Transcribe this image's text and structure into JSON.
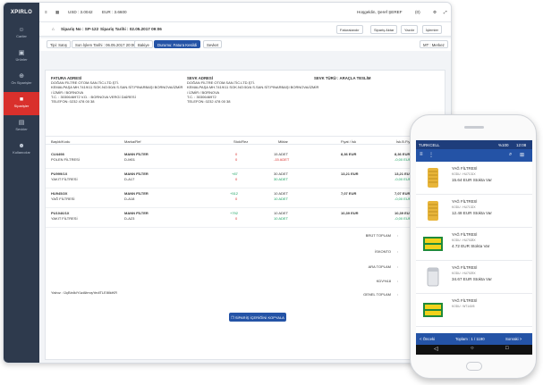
{
  "app": {
    "logo": "XPIRLO",
    "sidebar": [
      {
        "label": "Cariler",
        "icon": "user-icon"
      },
      {
        "label": "Ürünler",
        "icon": "box-icon"
      },
      {
        "label": "Ön Siparişler",
        "icon": "cart-icon"
      },
      {
        "label": "Siparişler",
        "icon": "bag-icon",
        "active": true
      },
      {
        "label": "Sevkler",
        "icon": "truck-icon"
      },
      {
        "label": "Kullanıcılar",
        "icon": "users-icon"
      }
    ],
    "topbar": {
      "menu_icon": "≡",
      "grid_icon": "▦",
      "usd": "USD : 3.0042",
      "eur": "EUR : 3.6600",
      "greeting": "Hoşgeldin, Şeref ŞEREF",
      "lang": "(0)"
    },
    "order": {
      "no": "Sipariş No : SP-122",
      "date": "Sipariş Tarihi : 02.05.2017 09:06",
      "buttons": [
        "Faturalandır",
        "Sipariş Aktar",
        "Yazdır",
        "İşlemler"
      ]
    },
    "status": {
      "type": "Tipi: Satış",
      "last_update": "Son İşlem Tarihi : 06.05.2017 20:06",
      "balance": "Bakiye",
      "state": "Durumu: Fatura Kesildi",
      "shipment": "Sevket",
      "warehouse": "MT : Merkez"
    },
    "addresses": {
      "invoice_title": "FATURA ADRESİ",
      "invoice_lines": [
        "DOĞAN FİLTRE OTOM.SAN.TİC.LTD.ŞTİ.",
        "KEMALPAŞA MH.7419/11 SOK.NO:50/A S.SAN.SİT.PINARBAŞI BORNOVA/İZMİR",
        "/ İZMİR / BORNOVA",
        "T.C. : 3030646972 V.D. : BORNOVA VERGİ DAİRESİ",
        "TELEFON: 0232 478 00 38"
      ],
      "shipping_title": "SEVK ADRESİ",
      "shipping_lines": [
        "DOĞAN FİLTRE OTOM.SAN.TİC.LTD.ŞTİ.",
        "KEMALPAŞA MH.7419/11 SOK.NO:50/A S.SAN.SİT.PINARBAŞI BORNOVA/İZMİR",
        "/ İZMİR / BORNOVA",
        "T.C. : 3030646972",
        "TELEFON: 0232 478 00 38"
      ],
      "shipping_type": "SEVK TÜRÜ : ARAÇLA TESLİM"
    },
    "table": {
      "headers": [
        "Başlık/Kodu",
        "Marka/Ref",
        "Stok/Rez",
        "Miktar",
        "Fiyat / İsk",
        "İsk.B.Fiyat"
      ],
      "rows": [
        {
          "code": "CU4498",
          "name": "POLEN FİLTRESİ",
          "brand": "MANN FİLTER",
          "ref": "D-M01",
          "stock": "0",
          "rez": "0",
          "qty": "15 ADET",
          "qty2": "-15 ADET",
          "price": "8,36 EUR",
          "disc": "",
          "final": "8,36 EUR",
          "final2": "-0,00 EUR"
        },
        {
          "code": "PU999/1X",
          "name": "YAKIT FİLTRESİ",
          "brand": "MANN FİLTER",
          "ref": "D-A17",
          "stock": "+87",
          "rez": "0",
          "qty": "30 ADET",
          "qty2": "30 ADET",
          "price": "13,21 EUR",
          "disc": "",
          "final": "13,21 EUR",
          "final2": "-0,00 EUR"
        },
        {
          "code": "HU945/2X",
          "name": "YAĞ FİLTRESİ",
          "brand": "MANN FİLTER",
          "ref": "D-A18",
          "stock": "+512",
          "rez": "0",
          "qty": "10 ADET",
          "qty2": "10 ADET",
          "price": "7,07 EUR",
          "disc": "",
          "final": "7,07 EUR",
          "final2": "-0,00 EUR"
        },
        {
          "code": "PU1046/1X",
          "name": "YAKIT FİLTRESİ",
          "brand": "MANN FİLTER",
          "ref": "D-A23",
          "stock": "+792",
          "rez": "0",
          "qty": "10 ADET",
          "qty2": "10 ADET",
          "price": "10,39 EUR",
          "disc": "",
          "final": "10,39 EUR",
          "final2": "-0,00 EUR"
        }
      ]
    },
    "totals": [
      "BRÜT TOPLAM",
      "İSKONTO",
      "ARA TOPLAM",
      "KDV%18",
      "GENEL TOPLAM"
    ],
    "amount_words": "Yalnız : ÜçBinİkiYüzAltmışYediTLElliİkiKR",
    "copy_button": "SİPARİŞ İÇERİĞİNİ KOPYALA"
  },
  "phone": {
    "carrier": "TURKCELL",
    "battery": "%100",
    "time": "12:08",
    "items": [
      {
        "name": "YAĞ FİLTRESİ",
        "code": "KODU : HU7131X",
        "price": "15.64 EUR Stokta Var"
      },
      {
        "name": "YAĞ FİLTRESİ",
        "code": "KODU : HU7132X",
        "price": "12.48 EUR Stokta Var"
      },
      {
        "name": "YAĞ FİLTRESİ",
        "code": "KODU : HU7028X",
        "price": "4.72 EUR Stokta Var"
      },
      {
        "name": "YAĞ FİLTRESİ",
        "code": "KODU : HU7029X",
        "price": "34.67 EUR Stokta Var"
      },
      {
        "name": "YAĞ FİLTRESİ",
        "code": "KODU : W7140/5",
        "price": ""
      }
    ],
    "prev": "< Önceki",
    "pagination": "Toplam : 1 / 1190",
    "next": "Sonraki >"
  }
}
